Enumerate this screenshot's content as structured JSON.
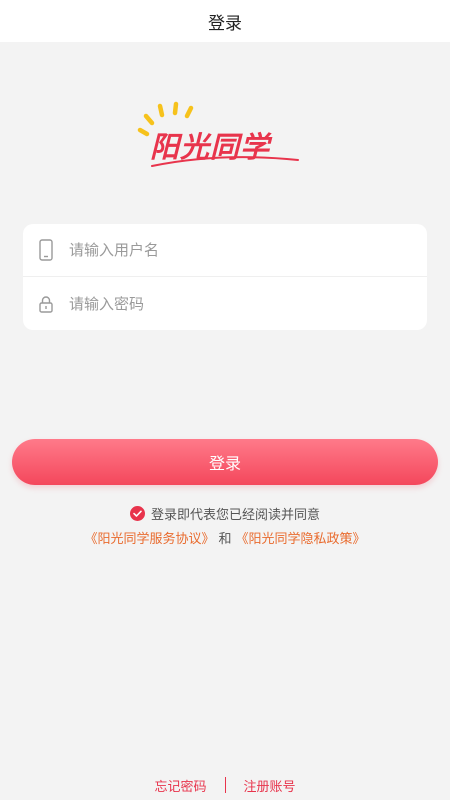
{
  "header": {
    "title": "登录"
  },
  "logo": {
    "text": "阳光同学"
  },
  "form": {
    "username_placeholder": "请输入用户名",
    "password_placeholder": "请输入密码"
  },
  "login_button": {
    "label": "登录"
  },
  "agreement": {
    "text": "登录即代表您已经阅读并同意",
    "service_link": "《阳光同学服务协议》",
    "and_text": "和",
    "privacy_link": "《阳光同学隐私政策》"
  },
  "footer": {
    "forgot_password": "忘记密码",
    "register": "注册账号"
  },
  "colors": {
    "brand_red": "#e8344c",
    "link_orange": "#e96b2e",
    "sun_yellow": "#f6c21c",
    "background": "#f3f3f3"
  },
  "icons": {
    "username": "phone-icon",
    "password": "lock-icon",
    "agreement": "check-circle-icon"
  }
}
